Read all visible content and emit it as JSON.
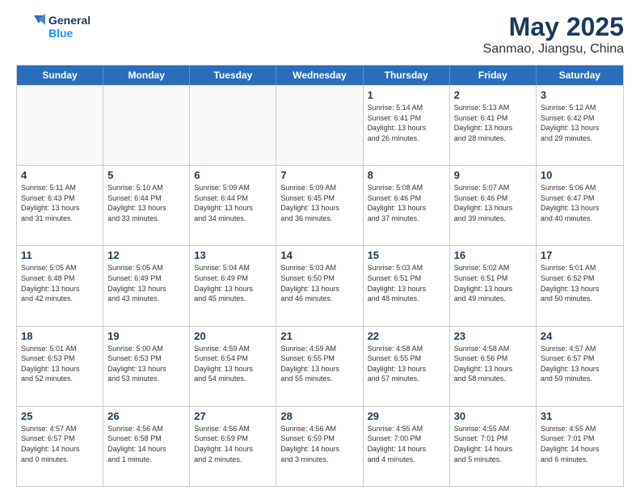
{
  "header": {
    "logo_line1": "General",
    "logo_line2": "Blue",
    "title": "May 2025",
    "subtitle": "Sanmao, Jiangsu, China"
  },
  "calendar": {
    "weekdays": [
      "Sunday",
      "Monday",
      "Tuesday",
      "Wednesday",
      "Thursday",
      "Friday",
      "Saturday"
    ],
    "rows": [
      [
        {
          "day": "",
          "info": "",
          "empty": true
        },
        {
          "day": "",
          "info": "",
          "empty": true
        },
        {
          "day": "",
          "info": "",
          "empty": true
        },
        {
          "day": "",
          "info": "",
          "empty": true
        },
        {
          "day": "1",
          "info": "Sunrise: 5:14 AM\nSunset: 6:41 PM\nDaylight: 13 hours\nand 26 minutes."
        },
        {
          "day": "2",
          "info": "Sunrise: 5:13 AM\nSunset: 6:41 PM\nDaylight: 13 hours\nand 28 minutes."
        },
        {
          "day": "3",
          "info": "Sunrise: 5:12 AM\nSunset: 6:42 PM\nDaylight: 13 hours\nand 29 minutes."
        }
      ],
      [
        {
          "day": "4",
          "info": "Sunrise: 5:11 AM\nSunset: 6:43 PM\nDaylight: 13 hours\nand 31 minutes."
        },
        {
          "day": "5",
          "info": "Sunrise: 5:10 AM\nSunset: 6:44 PM\nDaylight: 13 hours\nand 33 minutes."
        },
        {
          "day": "6",
          "info": "Sunrise: 5:09 AM\nSunset: 6:44 PM\nDaylight: 13 hours\nand 34 minutes."
        },
        {
          "day": "7",
          "info": "Sunrise: 5:09 AM\nSunset: 6:45 PM\nDaylight: 13 hours\nand 36 minutes."
        },
        {
          "day": "8",
          "info": "Sunrise: 5:08 AM\nSunset: 6:46 PM\nDaylight: 13 hours\nand 37 minutes."
        },
        {
          "day": "9",
          "info": "Sunrise: 5:07 AM\nSunset: 6:46 PM\nDaylight: 13 hours\nand 39 minutes."
        },
        {
          "day": "10",
          "info": "Sunrise: 5:06 AM\nSunset: 6:47 PM\nDaylight: 13 hours\nand 40 minutes."
        }
      ],
      [
        {
          "day": "11",
          "info": "Sunrise: 5:05 AM\nSunset: 6:48 PM\nDaylight: 13 hours\nand 42 minutes."
        },
        {
          "day": "12",
          "info": "Sunrise: 5:05 AM\nSunset: 6:49 PM\nDaylight: 13 hours\nand 43 minutes."
        },
        {
          "day": "13",
          "info": "Sunrise: 5:04 AM\nSunset: 6:49 PM\nDaylight: 13 hours\nand 45 minutes."
        },
        {
          "day": "14",
          "info": "Sunrise: 5:03 AM\nSunset: 6:50 PM\nDaylight: 13 hours\nand 46 minutes."
        },
        {
          "day": "15",
          "info": "Sunrise: 5:03 AM\nSunset: 6:51 PM\nDaylight: 13 hours\nand 48 minutes."
        },
        {
          "day": "16",
          "info": "Sunrise: 5:02 AM\nSunset: 6:51 PM\nDaylight: 13 hours\nand 49 minutes."
        },
        {
          "day": "17",
          "info": "Sunrise: 5:01 AM\nSunset: 6:52 PM\nDaylight: 13 hours\nand 50 minutes."
        }
      ],
      [
        {
          "day": "18",
          "info": "Sunrise: 5:01 AM\nSunset: 6:53 PM\nDaylight: 13 hours\nand 52 minutes."
        },
        {
          "day": "19",
          "info": "Sunrise: 5:00 AM\nSunset: 6:53 PM\nDaylight: 13 hours\nand 53 minutes."
        },
        {
          "day": "20",
          "info": "Sunrise: 4:59 AM\nSunset: 6:54 PM\nDaylight: 13 hours\nand 54 minutes."
        },
        {
          "day": "21",
          "info": "Sunrise: 4:59 AM\nSunset: 6:55 PM\nDaylight: 13 hours\nand 55 minutes."
        },
        {
          "day": "22",
          "info": "Sunrise: 4:58 AM\nSunset: 6:55 PM\nDaylight: 13 hours\nand 57 minutes."
        },
        {
          "day": "23",
          "info": "Sunrise: 4:58 AM\nSunset: 6:56 PM\nDaylight: 13 hours\nand 58 minutes."
        },
        {
          "day": "24",
          "info": "Sunrise: 4:57 AM\nSunset: 6:57 PM\nDaylight: 13 hours\nand 59 minutes."
        }
      ],
      [
        {
          "day": "25",
          "info": "Sunrise: 4:57 AM\nSunset: 6:57 PM\nDaylight: 14 hours\nand 0 minutes."
        },
        {
          "day": "26",
          "info": "Sunrise: 4:56 AM\nSunset: 6:58 PM\nDaylight: 14 hours\nand 1 minute."
        },
        {
          "day": "27",
          "info": "Sunrise: 4:56 AM\nSunset: 6:59 PM\nDaylight: 14 hours\nand 2 minutes."
        },
        {
          "day": "28",
          "info": "Sunrise: 4:56 AM\nSunset: 6:59 PM\nDaylight: 14 hours\nand 3 minutes."
        },
        {
          "day": "29",
          "info": "Sunrise: 4:55 AM\nSunset: 7:00 PM\nDaylight: 14 hours\nand 4 minutes."
        },
        {
          "day": "30",
          "info": "Sunrise: 4:55 AM\nSunset: 7:01 PM\nDaylight: 14 hours\nand 5 minutes."
        },
        {
          "day": "31",
          "info": "Sunrise: 4:55 AM\nSunset: 7:01 PM\nDaylight: 14 hours\nand 6 minutes."
        }
      ]
    ]
  }
}
